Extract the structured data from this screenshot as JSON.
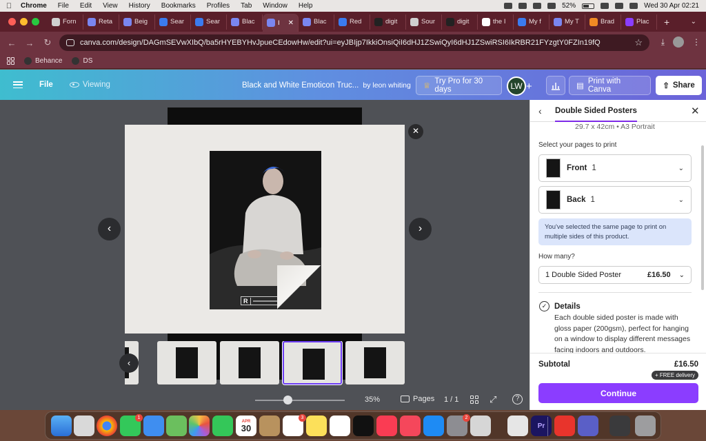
{
  "menubar": {
    "app": "Chrome",
    "items": [
      "File",
      "Edit",
      "View",
      "History",
      "Bookmarks",
      "Profiles",
      "Tab",
      "Window",
      "Help"
    ],
    "battery": "52%",
    "datetime": "Wed 30 Apr  02:21"
  },
  "tabs": [
    {
      "label": "Forn"
    },
    {
      "label": "Reta"
    },
    {
      "label": "Beig"
    },
    {
      "label": "Sear"
    },
    {
      "label": "Sear"
    },
    {
      "label": "Blac"
    },
    {
      "label": "I",
      "active": true
    },
    {
      "label": "Blac"
    },
    {
      "label": "Red"
    },
    {
      "label": "digit"
    },
    {
      "label": "Sour"
    },
    {
      "label": "digit"
    },
    {
      "label": "the I"
    },
    {
      "label": "My f"
    },
    {
      "label": "My T"
    },
    {
      "label": "Brad"
    },
    {
      "label": "Plac"
    }
  ],
  "address": {
    "url": "canva.com/design/DAGmSEVwXIbQ/ba5rHYEBYHvJpueCEdowHw/edit?ui=eyJBIjp7IkkiOnsiQiI6dHJ1ZSwiQyI6dHJ1ZSwiRSI6IkRBR21FYzgtY0FZIn19fQ"
  },
  "bookmarks": [
    {
      "label": "Behance"
    },
    {
      "label": "DS"
    }
  ],
  "header": {
    "file": "File",
    "viewing": "Viewing",
    "title": "Black and White Emoticon Truc...",
    "byline": "by leon whiting",
    "try_pro": "Try Pro for 30 days",
    "avatar": "LW",
    "print": "Print with Canva",
    "share": "Share"
  },
  "canvas": {
    "rating_letter": "R",
    "zoom": "35%",
    "pages_label": "Pages",
    "page_count": "1 / 1"
  },
  "panel": {
    "title": "Double Sided Posters",
    "subtitle": "29.7 x 42cm • A3 Portrait",
    "select_label": "Select your pages to print",
    "front_label": "Front",
    "front_num": "1",
    "back_label": "Back",
    "back_num": "1",
    "info": "You've selected the same page to print on multiple sides of this product.",
    "how_many": "How many?",
    "qty_label": "1 Double Sided Poster",
    "qty_price": "£16.50",
    "details_title": "Details",
    "details_text": "Each double sided poster is made with gloss paper (200gsm), perfect for hanging on a window to display different messages facing indoors and outdoors.",
    "subtotal_label": "Subtotal",
    "subtotal_value": "£16.50",
    "delivery": "+ FREE delivery",
    "continue": "Continue"
  },
  "dock": {
    "calendar_month": "APR",
    "calendar_day": "30",
    "badges": {
      "messages": "1",
      "reminders": "3",
      "settings": "2"
    }
  }
}
